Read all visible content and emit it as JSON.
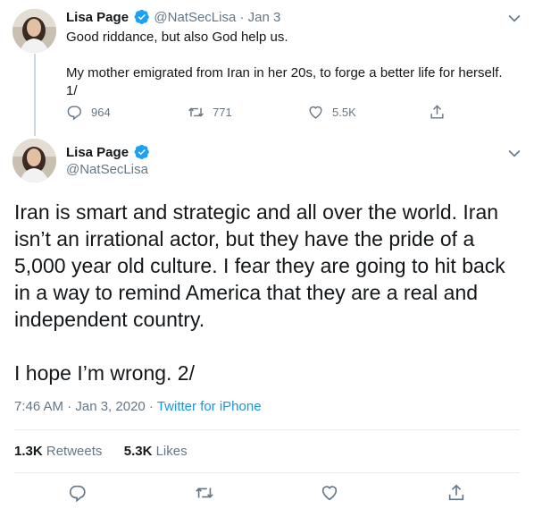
{
  "tweet1": {
    "name": "Lisa Page",
    "handle": "@NatSecLisa",
    "separator": "·",
    "date": "Jan 3",
    "paragraph1": "Good riddance, but also God help us.",
    "paragraph2": "My mother emigrated from Iran in her 20s, to forge a better life for herself. 1/",
    "replies": "964",
    "retweets": "771",
    "likes": "5.5K"
  },
  "tweet2": {
    "name": "Lisa Page",
    "handle": "@NatSecLisa",
    "paragraph1": "Iran is smart and strategic and all over the world. Iran isn’t an irrational actor, but they have the pride of a 5,000 year old culture. I fear they are going to hit back in a way to remind America that they are a real and independent country.",
    "paragraph2": "I hope I’m wrong. 2/",
    "time": "7:46 AM · Jan 3, 2020",
    "meta_separator": " · ",
    "source": "Twitter for iPhone",
    "retweet_count": "1.3K",
    "retweet_label": "Retweets",
    "like_count": "5.3K",
    "like_label": "Likes"
  },
  "icons": {
    "verified": "verified-badge-icon",
    "more": "chevron-down-icon",
    "reply": "reply-icon",
    "retweet": "retweet-icon",
    "like": "heart-icon",
    "share": "share-icon"
  },
  "colors": {
    "verified_blue": "#1da1f2",
    "link_blue": "#1b95e0",
    "secondary_text": "#657786",
    "primary_text": "#14171a"
  }
}
